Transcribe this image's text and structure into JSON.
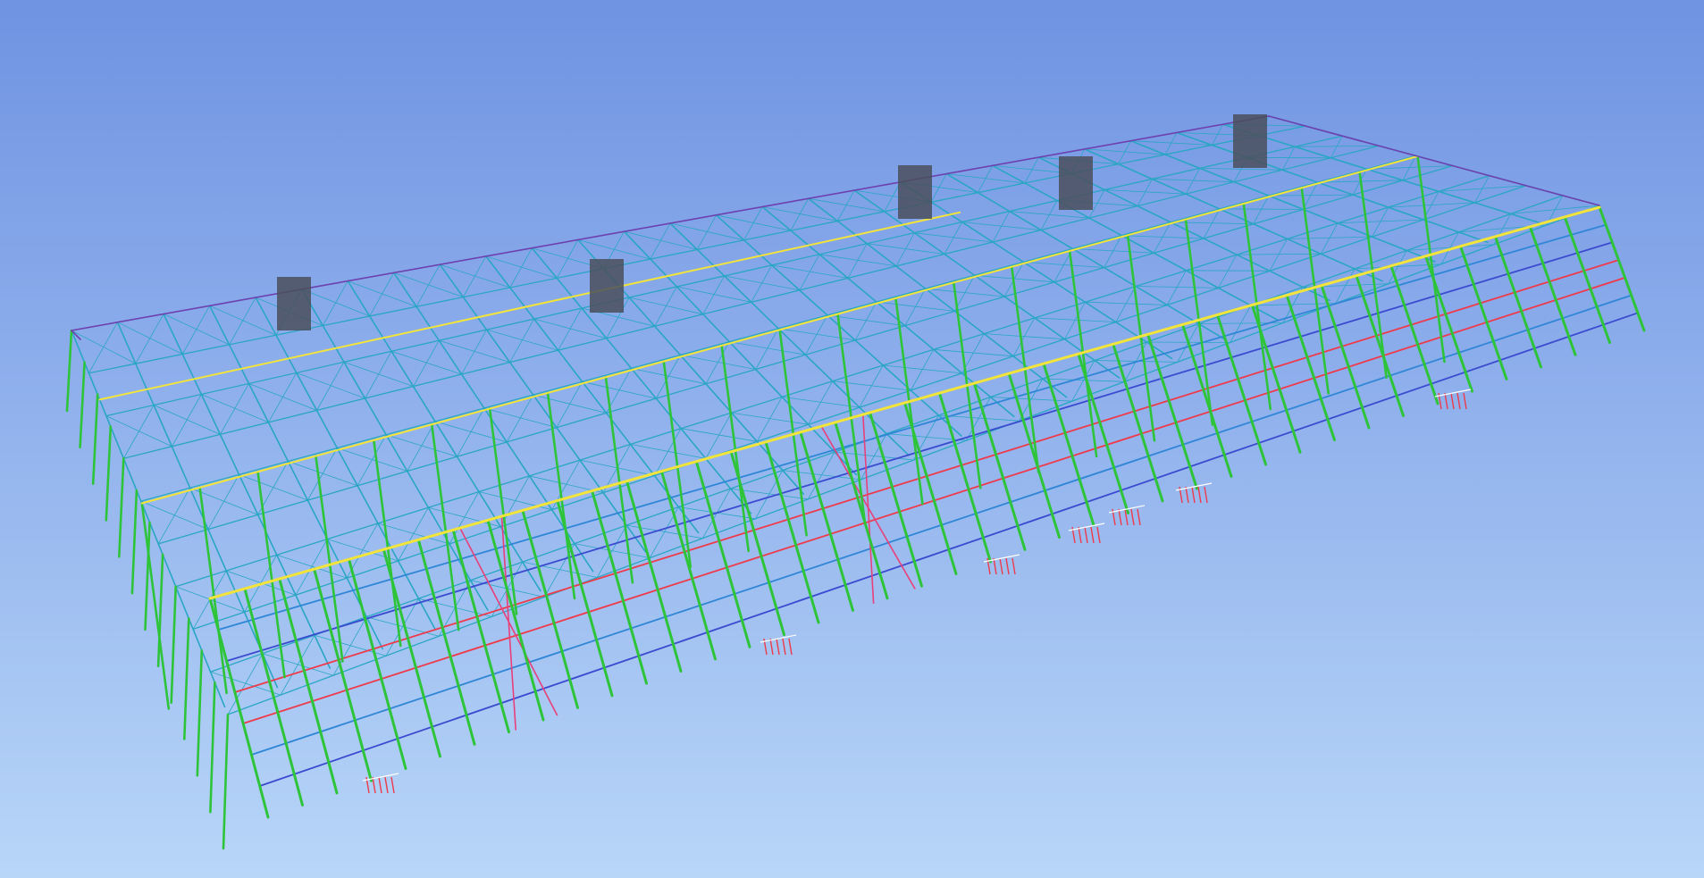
{
  "viewport": {
    "type": "3d-structural-model",
    "background_top": "#7093e2",
    "background_bottom": "#b8d6f8"
  },
  "colors": {
    "columns": "#2ec43a",
    "truss_members": "#2aa6c4",
    "girts": "#2f86d6",
    "tie_beams": "#3b4bd0",
    "eave_beams": "#f2e43a",
    "bracing": "#e8407a",
    "red_beams": "#ee3a4a",
    "roof_edge": "#7040b0",
    "roof_units": "#4a4f5c"
  },
  "icons": [
    "roof-unit-block-icon",
    "support-detail-icon"
  ]
}
